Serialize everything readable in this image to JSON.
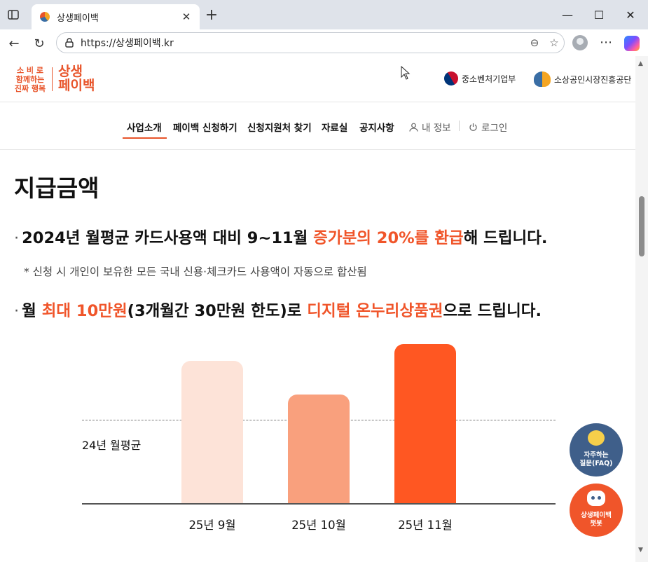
{
  "browser": {
    "tab_title": "상생페이백",
    "url": "https://상생페이백.kr"
  },
  "header": {
    "logo_tagline_lines": [
      "소 비 로",
      "함께하는",
      "진짜 행복"
    ],
    "logo_brand_lines": [
      "상생",
      "페이백"
    ],
    "agencies": [
      "중소벤처기업부",
      "소상공인시장진흥공단"
    ]
  },
  "gnb": {
    "items": [
      "사업소개",
      "페이백 신청하기",
      "신청지원처 찾기",
      "자료실",
      "공지사항"
    ],
    "active": "사업소개",
    "my_info": "내 정보",
    "login": "로그인"
  },
  "content": {
    "title": "지급금액",
    "line1": {
      "before": "2024년 월평균 카드사용액 대비 9~11월 ",
      "highlight": "증가분의 20%를 환급",
      "after": "해 드립니다."
    },
    "note": "* 신청 시 개인이 보유한 모든 국내 신용·체크카드 사용액이 자동으로 합산됨",
    "line2": {
      "part1": "월 ",
      "highlight1": "최대 10만원",
      "part2": "(3개월간 30만원 한도)로 ",
      "highlight2": "디지털 온누리상품권",
      "part3": "으로 드립니다."
    }
  },
  "chart_data": {
    "type": "bar",
    "categories": [
      "25년 9월",
      "25년 10월",
      "25년 11월"
    ],
    "values": [
      1.28,
      0.98,
      1.43
    ],
    "reference_line": {
      "label": "24년 월평균",
      "value": 0.75
    },
    "ylim": [
      0,
      1.5
    ],
    "colors": [
      "#fde3d8",
      "#f9a07d",
      "#ff5722"
    ],
    "grid": false
  },
  "fabs": {
    "faq": [
      "자주하는",
      "질문(FAQ)"
    ],
    "chatbot": [
      "상생페이백",
      "챗봇"
    ]
  }
}
